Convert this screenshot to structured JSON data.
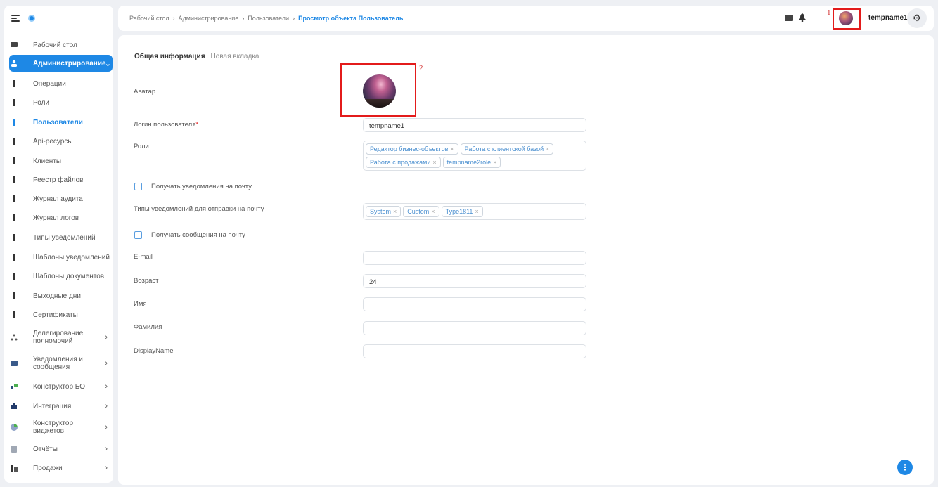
{
  "breadcrumb": [
    "Рабочий стол",
    "Администрирование",
    "Пользователи"
  ],
  "breadcrumb_current": "Просмотр объекта Пользователь",
  "breadcrumb_sep": "›",
  "header": {
    "username": "tempname1",
    "annotation_1": "1",
    "icons": [
      "mail-icon",
      "bell-icon",
      "gear-icon"
    ]
  },
  "sidebar": {
    "items": [
      {
        "label": "Рабочий стол",
        "icon": "desktop-icon"
      },
      {
        "label": "Администрирование",
        "icon": "admin-icon",
        "expanded_chevron": "⌄"
      },
      {
        "label": "Операции"
      },
      {
        "label": "Роли"
      },
      {
        "label": "Пользователи"
      },
      {
        "label": "Api-ресурсы"
      },
      {
        "label": "Клиенты"
      },
      {
        "label": "Реестр файлов"
      },
      {
        "label": "Журнал аудита"
      },
      {
        "label": "Журнал логов"
      },
      {
        "label": "Типы уведомлений"
      },
      {
        "label": "Шаблоны уведомлений"
      },
      {
        "label": "Шаблоны документов"
      },
      {
        "label": "Выходные дни"
      },
      {
        "label": "Сертификаты"
      },
      {
        "label": "Делегирование полномочий",
        "icon": "delegation-icon",
        "chevron": "›"
      },
      {
        "label": "Уведомления и сообщения",
        "icon": "envelope-icon",
        "chevron": "›"
      },
      {
        "label": "Конструктор БО",
        "icon": "constructor-icon",
        "chevron": "›"
      },
      {
        "label": "Интеграция",
        "icon": "puzzle-icon",
        "chevron": "›"
      },
      {
        "label": "Конструктор виджетов",
        "icon": "widget-icon",
        "chevron": "›"
      },
      {
        "label": "Отчёты",
        "icon": "report-icon",
        "chevron": "›"
      },
      {
        "label": "Продажи",
        "icon": "sales-icon",
        "chevron": "›"
      }
    ]
  },
  "tabs": {
    "active": "Общая информация",
    "other": "Новая вкладка"
  },
  "form": {
    "avatar_label": "Аватар",
    "annotation_2": "2",
    "login_label": "Логин пользователя",
    "login_required": "*",
    "login_value": "tempname1",
    "roles_label": "Роли",
    "roles": [
      "Редактор бизнес-объектов",
      "Работа с клиентской базой",
      "Работа с продажами",
      "tempname2role"
    ],
    "notify_email_label": "Получать уведомления на почту",
    "notify_types_label": "Типы уведомлений для отправки на почту",
    "notify_types": [
      "System",
      "Custom",
      "Type1811"
    ],
    "messages_email_label": "Получать сообщения на почту",
    "email_label": "E-mail",
    "email_value": "",
    "age_label": "Возраст",
    "age_value": "24",
    "name_label": "Имя",
    "name_value": "",
    "surname_label": "Фамилия",
    "surname_value": "",
    "displayname_label": "DisplayName",
    "displayname_value": ""
  },
  "chip_remove": "×",
  "fab_label": "⋮"
}
